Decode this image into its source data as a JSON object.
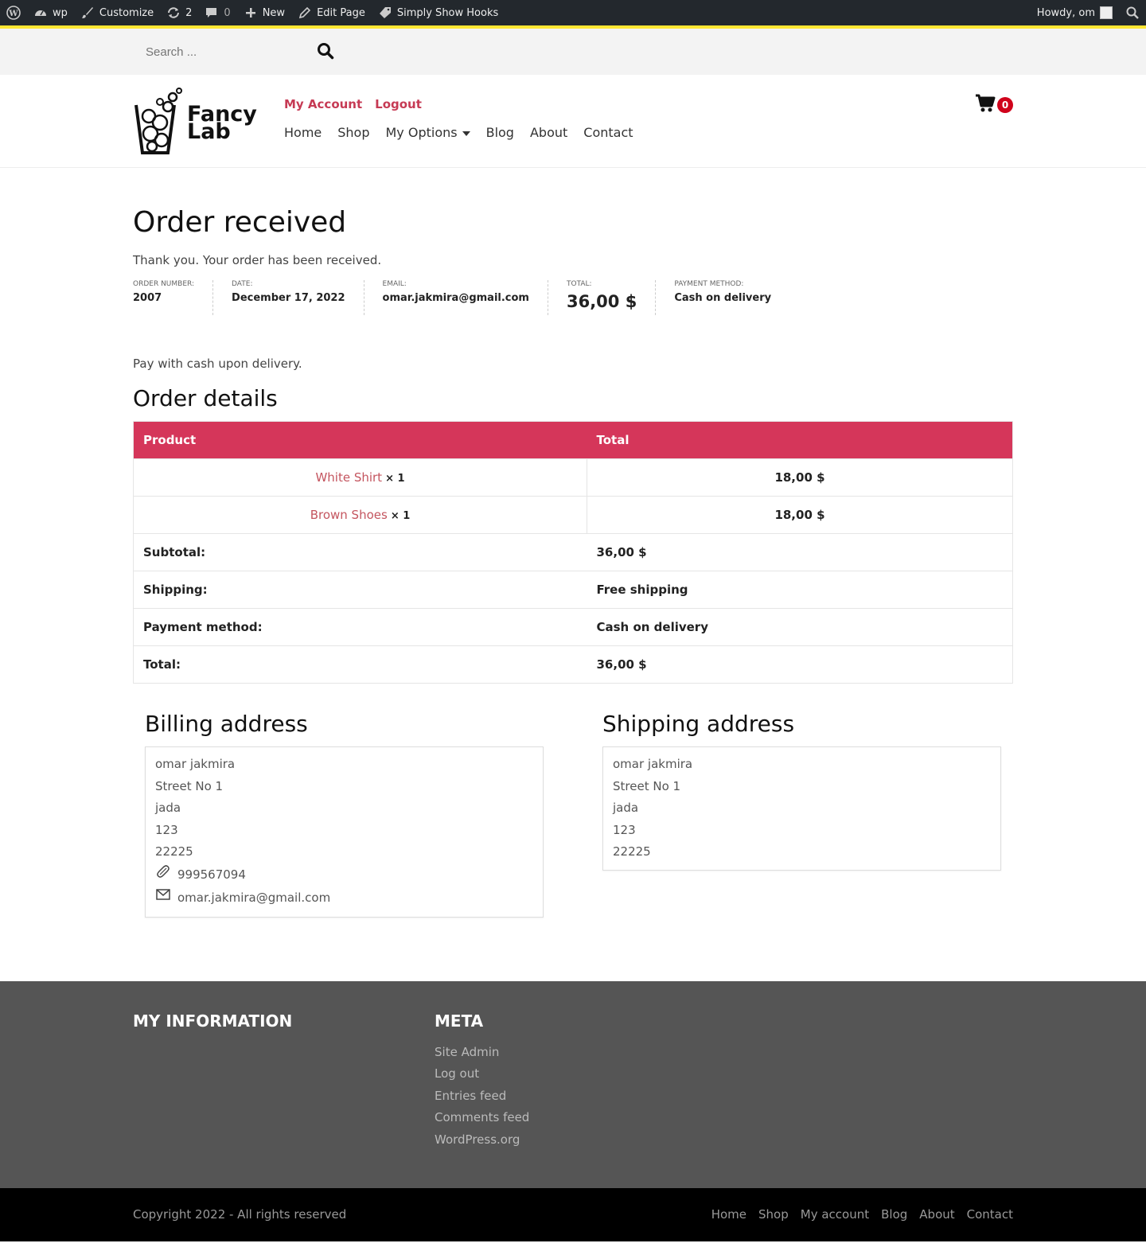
{
  "adminbar": {
    "site": "wp",
    "customize": "Customize",
    "updates": "2",
    "comments": "0",
    "new": "New",
    "edit_page": "Edit Page",
    "hooks": "Simply Show Hooks",
    "howdy": "Howdy, om"
  },
  "search": {
    "placeholder": "Search ..."
  },
  "header": {
    "logo_line1": "Fancy",
    "logo_line2": "Lab",
    "top_links": [
      "My Account",
      "Logout"
    ],
    "nav": [
      "Home",
      "Shop",
      "My Options",
      "Blog",
      "About",
      "Contact"
    ],
    "cart_count": "0",
    "accent": "#c63a54"
  },
  "main": {
    "title": "Order received",
    "thanks": "Thank you. Your order has been received.",
    "overview": [
      {
        "label": "ORDER NUMBER:",
        "value": "2007"
      },
      {
        "label": "DATE:",
        "value": "December 17, 2022"
      },
      {
        "label": "EMAIL:",
        "value": "omar.jakmira@gmail.com"
      },
      {
        "label": "TOTAL:",
        "value": "36,00 $"
      },
      {
        "label": "PAYMENT METHOD:",
        "value": "Cash on delivery"
      }
    ],
    "pay_note": "Pay with cash upon delivery.",
    "order_details_title": "Order details",
    "table": {
      "headers": [
        "Product",
        "Total"
      ],
      "items": [
        {
          "name": "White Shirt",
          "qty": "× 1",
          "total": "18,00 $"
        },
        {
          "name": "Brown Shoes",
          "qty": "× 1",
          "total": "18,00 $"
        }
      ],
      "summary": [
        {
          "label": "Subtotal:",
          "value": "36,00 $",
          "big": true
        },
        {
          "label": "Shipping:",
          "value": "Free shipping",
          "big": false
        },
        {
          "label": "Payment method:",
          "value": "Cash on delivery",
          "big": false
        },
        {
          "label": "Total:",
          "value": "36,00 $",
          "big": true
        }
      ],
      "header_color": "#d5365a"
    },
    "billing": {
      "title": "Billing address",
      "lines": [
        "omar jakmira",
        "Street No 1",
        "jada",
        "123",
        "22225"
      ],
      "phone": "999567094",
      "email": "omar.jakmira@gmail.com"
    },
    "shipping": {
      "title": "Shipping address",
      "lines": [
        "omar jakmira",
        "Street No 1",
        "jada",
        "123",
        "22225"
      ]
    }
  },
  "footer": {
    "col1_title": "MY INFORMATION",
    "meta_title": "META",
    "meta_links": [
      "Site Admin",
      "Log out",
      "Entries feed",
      "Comments feed",
      "WordPress.org"
    ],
    "copyright": "Copyright 2022 - All rights reserved",
    "nav": [
      "Home",
      "Shop",
      "My account",
      "Blog",
      "About",
      "Contact"
    ]
  }
}
